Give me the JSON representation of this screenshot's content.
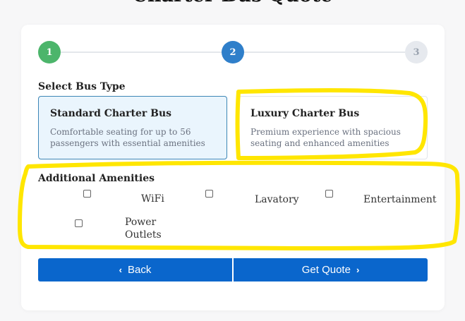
{
  "page": {
    "title": "Charter Bus Quote"
  },
  "stepper": {
    "steps": [
      {
        "label": "1",
        "state": "complete"
      },
      {
        "label": "2",
        "state": "active"
      },
      {
        "label": "3",
        "state": "pending"
      }
    ]
  },
  "bus_type": {
    "label": "Select Bus Type",
    "options": [
      {
        "title": "Standard Charter Bus",
        "description": "Comfortable seating for up to 56 passengers with essential amenities",
        "selected": true
      },
      {
        "title": "Luxury Charter Bus",
        "description": "Premium experience with spacious seating and enhanced amenities",
        "selected": false
      }
    ]
  },
  "amenities": {
    "label": "Additional Amenities",
    "items": [
      {
        "label": "WiFi",
        "checked": false
      },
      {
        "label": "Lavatory",
        "checked": false
      },
      {
        "label": "Entertainment",
        "checked": false
      },
      {
        "label": "Power Outlets",
        "checked": false
      }
    ]
  },
  "actions": {
    "back_label": "Back",
    "back_icon": "chevron-left-icon",
    "quote_label": "Get Quote",
    "quote_icon": "chevron-right-icon"
  },
  "colors": {
    "step_complete": "#4cb56b",
    "step_active": "#2f7fca",
    "primary_button": "#0a66cc",
    "annotation_highlight": "#ffe600"
  }
}
